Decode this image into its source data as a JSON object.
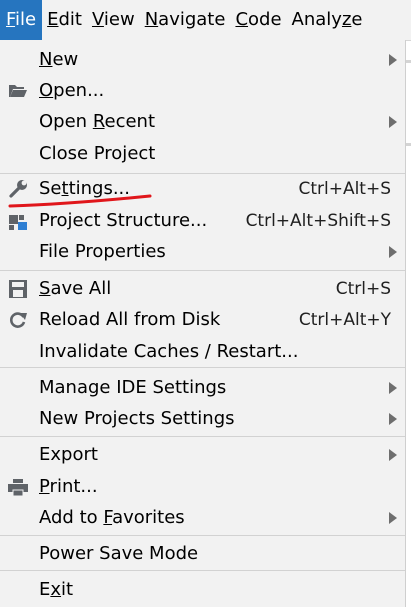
{
  "menubar": {
    "items": [
      {
        "pre": "",
        "mn": "F",
        "post": "ile",
        "active": true
      },
      {
        "pre": "",
        "mn": "E",
        "post": "dit"
      },
      {
        "pre": "",
        "mn": "V",
        "post": "iew"
      },
      {
        "pre": "",
        "mn": "N",
        "post": "avigate"
      },
      {
        "pre": "",
        "mn": "C",
        "post": "ode"
      },
      {
        "pre": "Analy",
        "mn": "z",
        "post": "e"
      }
    ]
  },
  "file_menu": {
    "items": [
      {
        "pre": "",
        "mn": "N",
        "post": "ew",
        "shortcut": "",
        "submenu": true,
        "icon": ""
      },
      {
        "pre": "",
        "mn": "O",
        "post": "pen...",
        "shortcut": "",
        "submenu": false,
        "icon": "folder-open-icon"
      },
      {
        "pre": "Open ",
        "mn": "R",
        "post": "ecent",
        "shortcut": "",
        "submenu": true,
        "icon": ""
      },
      {
        "pre": "Close Project",
        "mn": "",
        "post": "",
        "shortcut": "",
        "submenu": false,
        "icon": ""
      },
      {
        "pre": "Se",
        "mn": "t",
        "post": "tings...",
        "shortcut": "Ctrl+Alt+S",
        "submenu": false,
        "icon": "wrench-icon"
      },
      {
        "pre": "Project Structure...",
        "mn": "",
        "post": "",
        "shortcut": "Ctrl+Alt+Shift+S",
        "submenu": false,
        "icon": "project-structure-icon"
      },
      {
        "pre": "File Properties",
        "mn": "",
        "post": "",
        "shortcut": "",
        "submenu": true,
        "icon": ""
      },
      {
        "pre": "",
        "mn": "S",
        "post": "ave All",
        "shortcut": "Ctrl+S",
        "submenu": false,
        "icon": "save-icon"
      },
      {
        "pre": "Reload All from Disk",
        "mn": "",
        "post": "",
        "shortcut": "Ctrl+Alt+Y",
        "submenu": false,
        "icon": "reload-icon"
      },
      {
        "pre": "Invalidate Caches / Restart...",
        "mn": "",
        "post": "",
        "shortcut": "",
        "submenu": false,
        "icon": ""
      },
      {
        "pre": "Manage IDE Settings",
        "mn": "",
        "post": "",
        "shortcut": "",
        "submenu": true,
        "icon": ""
      },
      {
        "pre": "New Projects Settings",
        "mn": "",
        "post": "",
        "shortcut": "",
        "submenu": true,
        "icon": ""
      },
      {
        "pre": "Export",
        "mn": "",
        "post": "",
        "shortcut": "",
        "submenu": true,
        "icon": ""
      },
      {
        "pre": "",
        "mn": "P",
        "post": "rint...",
        "shortcut": "",
        "submenu": false,
        "icon": "print-icon"
      },
      {
        "pre": "Add to ",
        "mn": "F",
        "post": "avorites",
        "shortcut": "",
        "submenu": true,
        "icon": ""
      },
      {
        "pre": "Power Save Mode",
        "mn": "",
        "post": "",
        "shortcut": "",
        "submenu": false,
        "icon": ""
      },
      {
        "pre": "E",
        "mn": "x",
        "post": "it",
        "shortcut": "",
        "submenu": false,
        "icon": ""
      }
    ]
  },
  "colors": {
    "menubar_active_bg": "#2675bf",
    "menu_bg": "#f2f2f2",
    "annotation_underline": "#e0161b"
  }
}
